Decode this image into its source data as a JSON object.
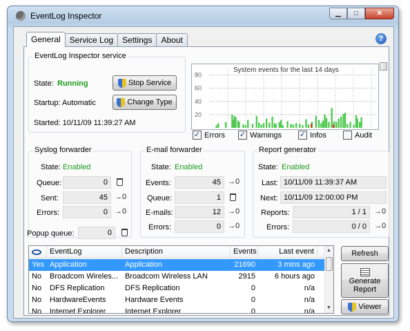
{
  "window": {
    "title": "EventLog Inspector"
  },
  "tabs": [
    "General",
    "Service Log",
    "Settings",
    "About"
  ],
  "service": {
    "group_label": "EventLog Inspector service",
    "state_label": "State:",
    "state_value": "Running",
    "startup_label": "Startup: Automatic",
    "started_label": "Started: 10/11/09 11:39:27 AM",
    "stop_button": "Stop Service",
    "change_button": "Change Type"
  },
  "chart": {
    "title": "System events for the last 14 days",
    "y_ticks": [
      "80",
      "60",
      "40",
      "20"
    ],
    "checks": [
      {
        "label": "Errors",
        "checked": true
      },
      {
        "label": "Warnings",
        "checked": true
      },
      {
        "label": "Infos",
        "checked": true
      },
      {
        "label": "Audit",
        "checked": false
      }
    ]
  },
  "chart_data": {
    "type": "bar",
    "title": "System events for the last 14 days",
    "ylim": [
      0,
      90
    ],
    "grid": true,
    "series": [
      {
        "name": "Errors",
        "color": "#d43b2a",
        "values": [
          0,
          0,
          0,
          0,
          0,
          0,
          0,
          0,
          0,
          0,
          0,
          0,
          0,
          0,
          0,
          0,
          0,
          0,
          0,
          0,
          0,
          0,
          0,
          0,
          0,
          0,
          0,
          0,
          0,
          0,
          0,
          0,
          0,
          0,
          0,
          0,
          0,
          0,
          0,
          0,
          0,
          0,
          0,
          0,
          0,
          0,
          0,
          0,
          0,
          0,
          0,
          0,
          0,
          0,
          0,
          0,
          0,
          0,
          0,
          0,
          0,
          0,
          0,
          0,
          0,
          0,
          0,
          0,
          0,
          0,
          0,
          0,
          0,
          0,
          0,
          0,
          0,
          0,
          0,
          0,
          0,
          0,
          0,
          0,
          0,
          0,
          0,
          0,
          0,
          0,
          0,
          0,
          0,
          0,
          0,
          0,
          0,
          0,
          0,
          0,
          0,
          0,
          0,
          0,
          0,
          0,
          0,
          0,
          0,
          0,
          0,
          0,
          0,
          0,
          0,
          0,
          0,
          0,
          0,
          0,
          0,
          0,
          0,
          0,
          0,
          0,
          0,
          0,
          0,
          0,
          0,
          0,
          0,
          0,
          0,
          0,
          0,
          0,
          0,
          0,
          0,
          0,
          0,
          0,
          0,
          0,
          0,
          0,
          0,
          0,
          0,
          0,
          0,
          0,
          0,
          0,
          0,
          0,
          0,
          0,
          0,
          0,
          0,
          0,
          0,
          0,
          0,
          0,
          0,
          0,
          0,
          0,
          0,
          0,
          0,
          0,
          0,
          0,
          0,
          0,
          0,
          0,
          0,
          0,
          0,
          0,
          0,
          0,
          0,
          0,
          0,
          0,
          0,
          0,
          0,
          0,
          0,
          0,
          0,
          0,
          0,
          0,
          0,
          0,
          0,
          0,
          0,
          0,
          0,
          0,
          0,
          0,
          0,
          0,
          0,
          0,
          0,
          0,
          0,
          0,
          0,
          0,
          0,
          0,
          0,
          0,
          0,
          0,
          0,
          0,
          0,
          0,
          0,
          0,
          0,
          0,
          0,
          0,
          0,
          0,
          0,
          0,
          0,
          0,
          0,
          0,
          0,
          0,
          0,
          0,
          0,
          0,
          0,
          0,
          0,
          0,
          0,
          0,
          0,
          0,
          0,
          0,
          0,
          0,
          0,
          0,
          0,
          0,
          0,
          0,
          0,
          0,
          0,
          0,
          0,
          0
        ]
      },
      {
        "name": "Infos",
        "color": "#4fc94f",
        "values": [
          0,
          0,
          0,
          0,
          0,
          0,
          0,
          0,
          0,
          0,
          0,
          0,
          0,
          0,
          0,
          0,
          0,
          0,
          0,
          0,
          0,
          0,
          0,
          0,
          0,
          0,
          0,
          0,
          0,
          0,
          0,
          0,
          0,
          0,
          0,
          0,
          0,
          0,
          0,
          0,
          0,
          0,
          0,
          0,
          0,
          0,
          0,
          0,
          0,
          0,
          0,
          0,
          0,
          0,
          0,
          0,
          0,
          0,
          0,
          0,
          0,
          0,
          0,
          0,
          0,
          0,
          0,
          0,
          0,
          0,
          0,
          0,
          0,
          0,
          0,
          0,
          0,
          0,
          0,
          0,
          0,
          0,
          0,
          0,
          0,
          0,
          0,
          0,
          0,
          0,
          0,
          0,
          0,
          0,
          0,
          0,
          0,
          0,
          0,
          0,
          0,
          0,
          0,
          0,
          0,
          0,
          0,
          0,
          0,
          0,
          0,
          0,
          0,
          0,
          0,
          0,
          0,
          0,
          0,
          0,
          0,
          0,
          0,
          0,
          0,
          0,
          0,
          0,
          0,
          0,
          0,
          0,
          0,
          0,
          0,
          0,
          0,
          0,
          0,
          0,
          0,
          0,
          0,
          0,
          0,
          0,
          0,
          0,
          0,
          0,
          0,
          0,
          0,
          0,
          0,
          0,
          0,
          0,
          0,
          0,
          0,
          0,
          0,
          0,
          0,
          0,
          0,
          0,
          0,
          0,
          0,
          0,
          0,
          0,
          0,
          0,
          0,
          0,
          0,
          0,
          0,
          0,
          0,
          0,
          0,
          0,
          0,
          0,
          0,
          0,
          0,
          0,
          0,
          0,
          0,
          0,
          0,
          0,
          0,
          0,
          0,
          0,
          0,
          0,
          0,
          0,
          0,
          0,
          0,
          0,
          0,
          0,
          0,
          0,
          0,
          0,
          0,
          0,
          0,
          0,
          0,
          0,
          0,
          0,
          0,
          0,
          0,
          0,
          0,
          0,
          0,
          0,
          0,
          0,
          0,
          0,
          0,
          0,
          0,
          0,
          0,
          0,
          0,
          0,
          0,
          0,
          0,
          0,
          0,
          0,
          0,
          0,
          0,
          0,
          0,
          0,
          0,
          0,
          0,
          0,
          0,
          0,
          0,
          0,
          0,
          0,
          0,
          0,
          0,
          0,
          0,
          0,
          0,
          0,
          0
        ]
      }
    ],
    "bars": [
      {
        "i": 10,
        "v": 4,
        "s": "Infos"
      },
      {
        "i": 13,
        "v": 7,
        "s": "Infos"
      },
      {
        "i": 26,
        "v": 9,
        "s": "Infos"
      },
      {
        "i": 37,
        "v": 20,
        "s": "Infos"
      },
      {
        "i": 39,
        "v": 12,
        "s": "Infos"
      },
      {
        "i": 41,
        "v": 18,
        "s": "Infos"
      },
      {
        "i": 43,
        "v": 16,
        "s": "Infos"
      },
      {
        "i": 47,
        "v": 11,
        "s": "Infos"
      },
      {
        "i": 49,
        "v": 9,
        "s": "Infos"
      },
      {
        "i": 56,
        "v": 5,
        "s": "Infos"
      },
      {
        "i": 60,
        "v": 4,
        "s": "Infos"
      },
      {
        "i": 64,
        "v": 12,
        "s": "Infos"
      },
      {
        "i": 72,
        "v": 6,
        "s": "Infos"
      },
      {
        "i": 79,
        "v": 18,
        "s": "Infos"
      },
      {
        "i": 83,
        "v": 8,
        "s": "Infos"
      },
      {
        "i": 87,
        "v": 5,
        "s": "Infos"
      },
      {
        "i": 91,
        "v": 7,
        "s": "Infos"
      },
      {
        "i": 96,
        "v": 14,
        "s": "Infos"
      },
      {
        "i": 101,
        "v": 8,
        "s": "Infos"
      },
      {
        "i": 106,
        "v": 17,
        "s": "Infos"
      },
      {
        "i": 110,
        "v": 7,
        "s": "Infos"
      },
      {
        "i": 112,
        "v": 6,
        "s": "Infos"
      },
      {
        "i": 118,
        "v": 9,
        "s": "Infos"
      },
      {
        "i": 121,
        "v": 12,
        "s": "Infos"
      },
      {
        "i": 124,
        "v": 4,
        "s": "Infos"
      },
      {
        "i": 132,
        "v": 10,
        "s": "Infos"
      },
      {
        "i": 138,
        "v": 6,
        "s": "Infos"
      },
      {
        "i": 142,
        "v": 5,
        "s": "Infos"
      },
      {
        "i": 147,
        "v": 7,
        "s": "Infos"
      },
      {
        "i": 153,
        "v": 6,
        "s": "Infos"
      },
      {
        "i": 158,
        "v": 4,
        "s": "Infos"
      },
      {
        "i": 164,
        "v": 13,
        "s": "Infos"
      },
      {
        "i": 168,
        "v": 5,
        "s": "Infos"
      },
      {
        "i": 174,
        "v": 9,
        "s": "Infos"
      },
      {
        "i": 181,
        "v": 18,
        "s": "Infos"
      },
      {
        "i": 186,
        "v": 12,
        "s": "Infos"
      },
      {
        "i": 190,
        "v": 7,
        "s": "Infos"
      },
      {
        "i": 193,
        "v": 11,
        "s": "Infos"
      },
      {
        "i": 196,
        "v": 20,
        "s": "Infos"
      },
      {
        "i": 199,
        "v": 15,
        "s": "Infos"
      },
      {
        "i": 203,
        "v": 9,
        "s": "Infos"
      },
      {
        "i": 208,
        "v": 30,
        "s": "Infos"
      },
      {
        "i": 212,
        "v": 10,
        "s": "Infos"
      },
      {
        "i": 216,
        "v": 9,
        "s": "Infos"
      },
      {
        "i": 220,
        "v": 14,
        "s": "Infos"
      },
      {
        "i": 224,
        "v": 17,
        "s": "Infos"
      },
      {
        "i": 228,
        "v": 21,
        "s": "Infos"
      },
      {
        "i": 231,
        "v": 23,
        "s": "Infos"
      },
      {
        "i": 235,
        "v": 6,
        "s": "Infos"
      },
      {
        "i": 240,
        "v": 9,
        "s": "Infos"
      },
      {
        "i": 246,
        "v": 5,
        "s": "Infos"
      },
      {
        "i": 250,
        "v": 19,
        "s": "Infos"
      },
      {
        "i": 252,
        "v": 14,
        "s": "Infos"
      },
      {
        "i": 256,
        "v": 9,
        "s": "Infos"
      },
      {
        "i": 259,
        "v": 16,
        "s": "Infos"
      },
      {
        "i": 173,
        "v": 6,
        "s": "Errors"
      },
      {
        "i": 211,
        "v": 5,
        "s": "Errors"
      }
    ]
  },
  "syslog": {
    "group_label": "Syslog forwarder",
    "state_label": "State:",
    "state_value": "Enabled",
    "queue_label": "Queue:",
    "queue_value": "0",
    "sent_label": "Sent:",
    "sent_value": "45",
    "errors_label": "Errors:",
    "errors_value": "0"
  },
  "email": {
    "group_label": "E-mail forwarder",
    "state_label": "State:",
    "state_value": "Enabled",
    "events_label": "Events:",
    "events_value": "45",
    "queue_label": "Queue:",
    "queue_value": "1",
    "emails_label": "E-mails:",
    "emails_value": "12",
    "errors_label": "Errors:",
    "errors_value": "0"
  },
  "report": {
    "group_label": "Report generator",
    "state_label": "State:",
    "state_value": "Enabled",
    "last_label": "Last:",
    "last_value": "10/11/09 11:39:37 AM",
    "next_label": "Next:",
    "next_value": "10/11/09 12:00:00 PM",
    "reports_label": "Reports:",
    "reports_value": "1 / 1",
    "errors_label": "Errors:",
    "errors_value": "0 / 0"
  },
  "popup": {
    "label": "Popup queue:",
    "value": "0"
  },
  "reset_glyph": "→0",
  "list": {
    "headers": [
      "EventLog",
      "Description",
      "Events",
      "Last event"
    ],
    "rows": [
      {
        "on": "Yes",
        "log": "Application",
        "desc": "Application",
        "events": "21690",
        "last": "3 mins ago",
        "selected": true
      },
      {
        "on": "No",
        "log": "Broadcom Wireles...",
        "desc": "Broadcom Wireless LAN",
        "events": "2915",
        "last": "6 hours ago",
        "selected": false
      },
      {
        "on": "No",
        "log": "DFS Replication",
        "desc": "DFS Replication",
        "events": "0",
        "last": "n/a",
        "selected": false
      },
      {
        "on": "No",
        "log": "HardwareEvents",
        "desc": "Hardware Events",
        "events": "0",
        "last": "n/a",
        "selected": false
      },
      {
        "on": "No",
        "log": "Internet Explorer",
        "desc": "Internet Explorer",
        "events": "0",
        "last": "n/a",
        "selected": false
      }
    ]
  },
  "side_buttons": {
    "refresh": "Refresh",
    "generate": "Generate Report",
    "viewer": "Viewer"
  }
}
